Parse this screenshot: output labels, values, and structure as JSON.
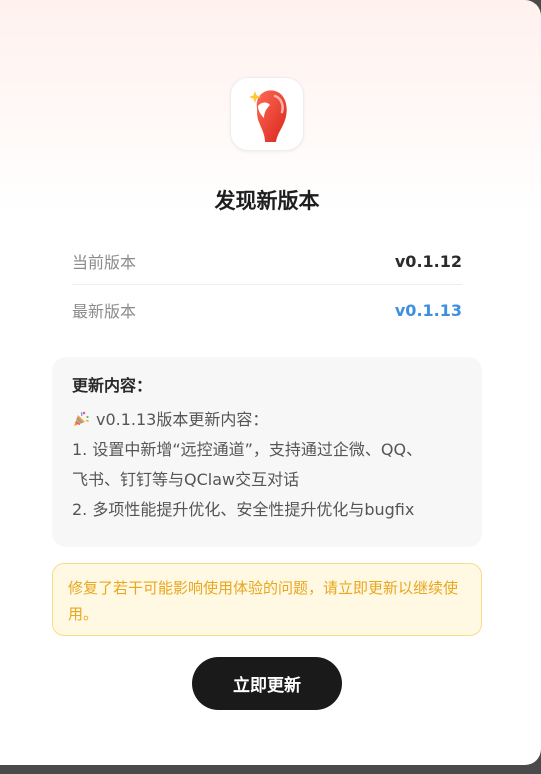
{
  "dialog": {
    "logo_icon": "lobster-claw-icon",
    "title": "发现新版本",
    "current_version_label": "当前版本",
    "current_version_value": "v0.1.12",
    "latest_version_label": "最新版本",
    "latest_version_value": "v0.1.13",
    "latest_version_color": "#3d8fe0"
  },
  "release_notes": {
    "heading": "更新内容：",
    "emoji_icon": "party-popper-icon",
    "lines": [
      "v0.1.13版本更新内容：",
      "1. 设置中新增“远控通道”，支持通过企微、QQ、",
      "飞书、钉钉等与QClaw交互对话",
      "2. 多项性能提升优化、安全性提升优化与bugfix"
    ]
  },
  "warning": {
    "text": "修复了若干可能影响使用体验的问题，请立即更新以继续使用。",
    "color": "#e8a71f"
  },
  "actions": {
    "update_label": "立即更新"
  }
}
